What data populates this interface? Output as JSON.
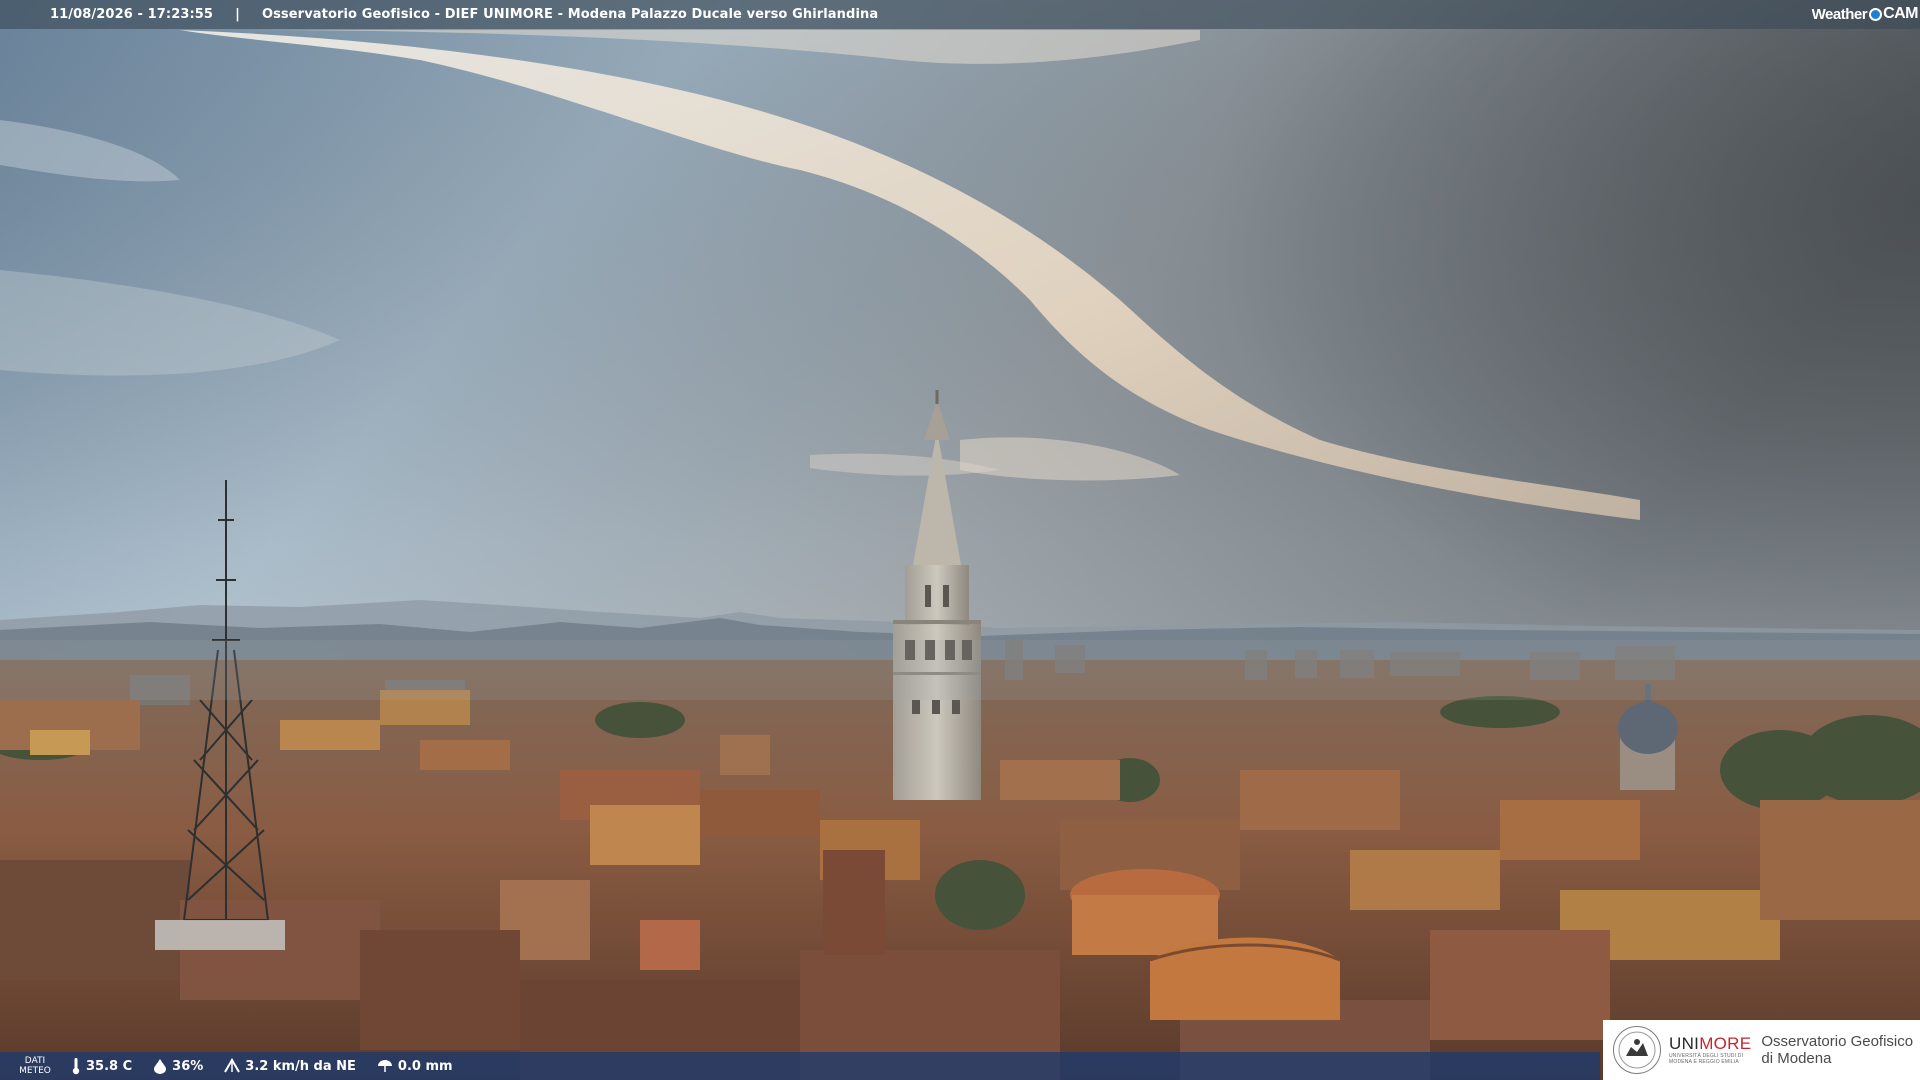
{
  "header": {
    "timestamp": "11/08/2026 - 17:23:55",
    "separator": "|",
    "title": "Osservatorio Geofisico - DIEF UNIMORE - Modena Palazzo Ducale verso Ghirlandina"
  },
  "watermark": {
    "weather": "Weather",
    "cam": "CAM"
  },
  "weather_bar": {
    "label_line1": "DATI",
    "label_line2": "METEO",
    "temperature": "35.8 C",
    "humidity": "36%",
    "wind": "3.2 km/h da NE",
    "rain": "0.0 mm",
    "icons": [
      "thermometer-icon",
      "humidity-drop-icon",
      "wind-icon",
      "rain-gauge-icon"
    ]
  },
  "logo": {
    "uni": "UNI",
    "more": "MORE",
    "subtitle_line1": "UNIVERSITÀ DEGLI STUDI DI",
    "subtitle_line2": "MODENA E REGGIO EMILIA",
    "observatory_line1": "Osservatorio Geofisico",
    "observatory_line2": "di Modena"
  },
  "colors": {
    "sky_top": "#7d93a8",
    "sky_mid": "#a9bcc8",
    "cloud": "#e8dccb",
    "rooftops": "#8a5a40",
    "brand_red": "#c4262e",
    "bar_blue": "#1e3a6e"
  }
}
